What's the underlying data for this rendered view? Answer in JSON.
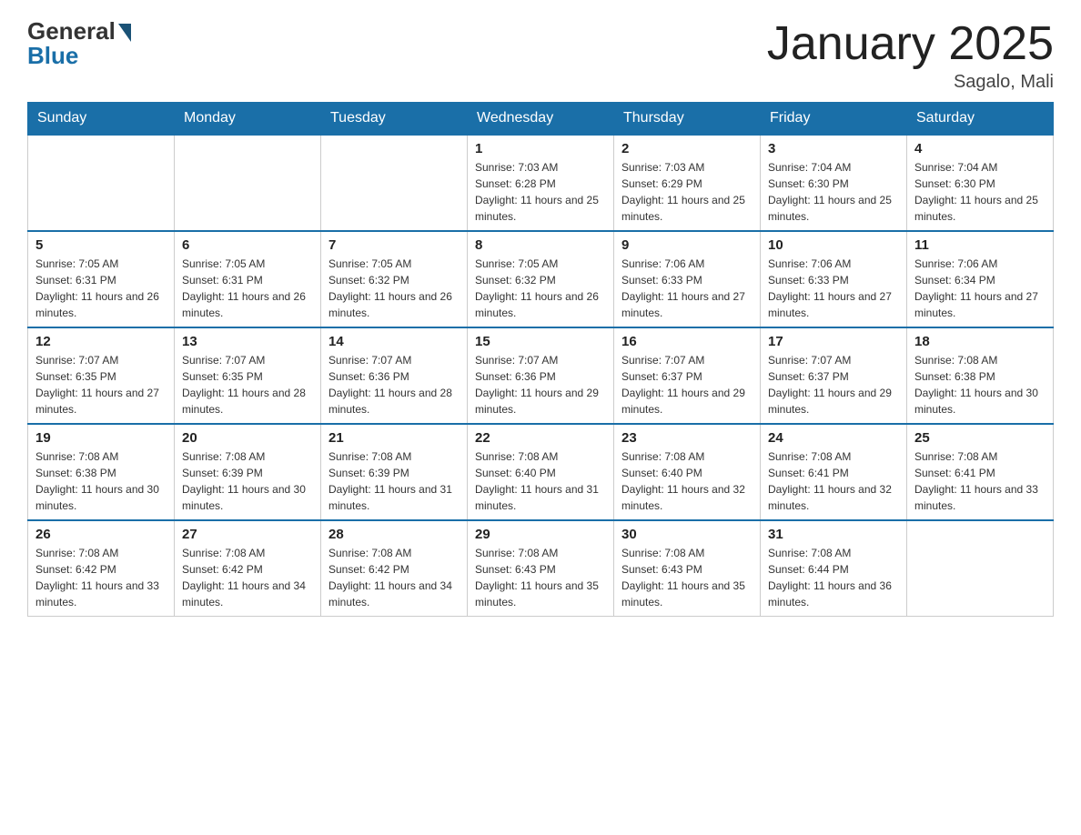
{
  "logo": {
    "general": "General",
    "blue": "Blue"
  },
  "header": {
    "title": "January 2025",
    "location": "Sagalo, Mali"
  },
  "days_of_week": [
    "Sunday",
    "Monday",
    "Tuesday",
    "Wednesday",
    "Thursday",
    "Friday",
    "Saturday"
  ],
  "weeks": [
    [
      {
        "day": "",
        "info": ""
      },
      {
        "day": "",
        "info": ""
      },
      {
        "day": "",
        "info": ""
      },
      {
        "day": "1",
        "info": "Sunrise: 7:03 AM\nSunset: 6:28 PM\nDaylight: 11 hours and 25 minutes."
      },
      {
        "day": "2",
        "info": "Sunrise: 7:03 AM\nSunset: 6:29 PM\nDaylight: 11 hours and 25 minutes."
      },
      {
        "day": "3",
        "info": "Sunrise: 7:04 AM\nSunset: 6:30 PM\nDaylight: 11 hours and 25 minutes."
      },
      {
        "day": "4",
        "info": "Sunrise: 7:04 AM\nSunset: 6:30 PM\nDaylight: 11 hours and 25 minutes."
      }
    ],
    [
      {
        "day": "5",
        "info": "Sunrise: 7:05 AM\nSunset: 6:31 PM\nDaylight: 11 hours and 26 minutes."
      },
      {
        "day": "6",
        "info": "Sunrise: 7:05 AM\nSunset: 6:31 PM\nDaylight: 11 hours and 26 minutes."
      },
      {
        "day": "7",
        "info": "Sunrise: 7:05 AM\nSunset: 6:32 PM\nDaylight: 11 hours and 26 minutes."
      },
      {
        "day": "8",
        "info": "Sunrise: 7:05 AM\nSunset: 6:32 PM\nDaylight: 11 hours and 26 minutes."
      },
      {
        "day": "9",
        "info": "Sunrise: 7:06 AM\nSunset: 6:33 PM\nDaylight: 11 hours and 27 minutes."
      },
      {
        "day": "10",
        "info": "Sunrise: 7:06 AM\nSunset: 6:33 PM\nDaylight: 11 hours and 27 minutes."
      },
      {
        "day": "11",
        "info": "Sunrise: 7:06 AM\nSunset: 6:34 PM\nDaylight: 11 hours and 27 minutes."
      }
    ],
    [
      {
        "day": "12",
        "info": "Sunrise: 7:07 AM\nSunset: 6:35 PM\nDaylight: 11 hours and 27 minutes."
      },
      {
        "day": "13",
        "info": "Sunrise: 7:07 AM\nSunset: 6:35 PM\nDaylight: 11 hours and 28 minutes."
      },
      {
        "day": "14",
        "info": "Sunrise: 7:07 AM\nSunset: 6:36 PM\nDaylight: 11 hours and 28 minutes."
      },
      {
        "day": "15",
        "info": "Sunrise: 7:07 AM\nSunset: 6:36 PM\nDaylight: 11 hours and 29 minutes."
      },
      {
        "day": "16",
        "info": "Sunrise: 7:07 AM\nSunset: 6:37 PM\nDaylight: 11 hours and 29 minutes."
      },
      {
        "day": "17",
        "info": "Sunrise: 7:07 AM\nSunset: 6:37 PM\nDaylight: 11 hours and 29 minutes."
      },
      {
        "day": "18",
        "info": "Sunrise: 7:08 AM\nSunset: 6:38 PM\nDaylight: 11 hours and 30 minutes."
      }
    ],
    [
      {
        "day": "19",
        "info": "Sunrise: 7:08 AM\nSunset: 6:38 PM\nDaylight: 11 hours and 30 minutes."
      },
      {
        "day": "20",
        "info": "Sunrise: 7:08 AM\nSunset: 6:39 PM\nDaylight: 11 hours and 30 minutes."
      },
      {
        "day": "21",
        "info": "Sunrise: 7:08 AM\nSunset: 6:39 PM\nDaylight: 11 hours and 31 minutes."
      },
      {
        "day": "22",
        "info": "Sunrise: 7:08 AM\nSunset: 6:40 PM\nDaylight: 11 hours and 31 minutes."
      },
      {
        "day": "23",
        "info": "Sunrise: 7:08 AM\nSunset: 6:40 PM\nDaylight: 11 hours and 32 minutes."
      },
      {
        "day": "24",
        "info": "Sunrise: 7:08 AM\nSunset: 6:41 PM\nDaylight: 11 hours and 32 minutes."
      },
      {
        "day": "25",
        "info": "Sunrise: 7:08 AM\nSunset: 6:41 PM\nDaylight: 11 hours and 33 minutes."
      }
    ],
    [
      {
        "day": "26",
        "info": "Sunrise: 7:08 AM\nSunset: 6:42 PM\nDaylight: 11 hours and 33 minutes."
      },
      {
        "day": "27",
        "info": "Sunrise: 7:08 AM\nSunset: 6:42 PM\nDaylight: 11 hours and 34 minutes."
      },
      {
        "day": "28",
        "info": "Sunrise: 7:08 AM\nSunset: 6:42 PM\nDaylight: 11 hours and 34 minutes."
      },
      {
        "day": "29",
        "info": "Sunrise: 7:08 AM\nSunset: 6:43 PM\nDaylight: 11 hours and 35 minutes."
      },
      {
        "day": "30",
        "info": "Sunrise: 7:08 AM\nSunset: 6:43 PM\nDaylight: 11 hours and 35 minutes."
      },
      {
        "day": "31",
        "info": "Sunrise: 7:08 AM\nSunset: 6:44 PM\nDaylight: 11 hours and 36 minutes."
      },
      {
        "day": "",
        "info": ""
      }
    ]
  ]
}
